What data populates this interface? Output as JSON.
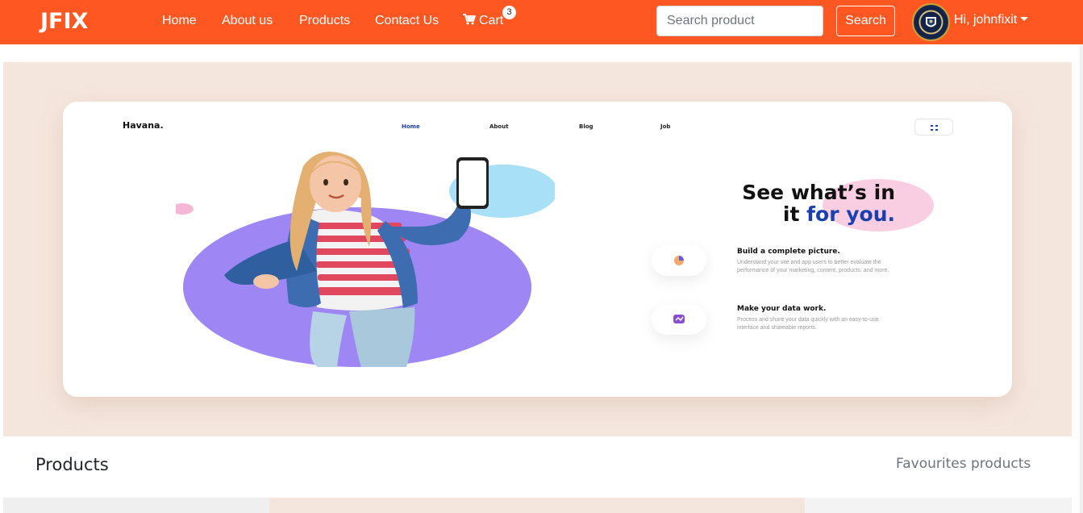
{
  "navbar": {
    "brand": "JFIX",
    "links": [
      "Home",
      "About us",
      "Products",
      "Contact Us"
    ],
    "cart_label": "Cart",
    "cart_count": "3",
    "search_placeholder": "Search product",
    "search_button": "Search",
    "user_greeting": "Hi, johnfixit",
    "bg_color": "#ff5722"
  },
  "hero": {
    "mini_brand": "Havana.",
    "mini_nav": [
      "Home",
      "About",
      "Blog",
      "Job"
    ],
    "headline_line1": "See what’s in",
    "headline_line2_a": "it ",
    "headline_line2_b": "for you.",
    "features": [
      {
        "title": "Build a complete picture.",
        "text": "Understand your site and app users to better evaluate the performance of your marketing, content, products, and more."
      },
      {
        "title": "Make your data work.",
        "text": "Process and share your data quickly with an easy-to-use interface and shareable reports."
      }
    ],
    "bg_color": "#f5e6dd"
  },
  "section": {
    "products_title": "Products",
    "favourites_link": "Favourites products"
  }
}
